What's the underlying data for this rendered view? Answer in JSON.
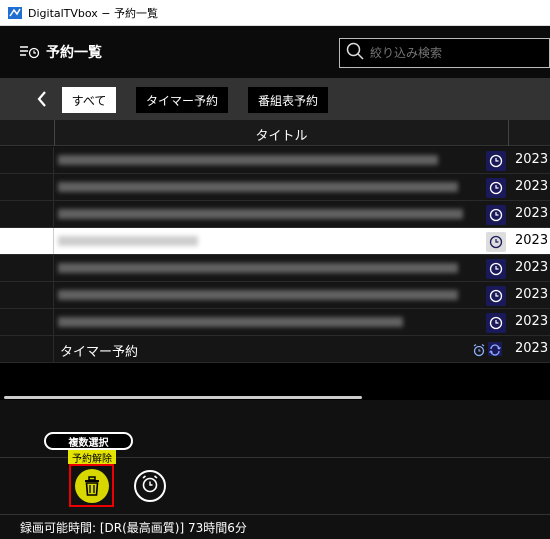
{
  "window": {
    "title": "DigitalTVbox − 予約一覧"
  },
  "header": {
    "title": "予約一覧",
    "search_placeholder": "絞り込み検索"
  },
  "filters": {
    "all": "すべて",
    "timer": "タイマー予約",
    "epg": "番組表予約"
  },
  "table": {
    "column_title": "タイトル",
    "rows": [
      {
        "date": "2023"
      },
      {
        "date": "2023"
      },
      {
        "date": "2023"
      },
      {
        "date": "2023"
      },
      {
        "date": "2023"
      },
      {
        "date": "2023"
      },
      {
        "date": "2023"
      },
      {
        "title": "タイマー予約",
        "date": "2023"
      }
    ]
  },
  "actions": {
    "multi_select": "複数選択",
    "cancel_reservation": "予約解除"
  },
  "status": {
    "recordable_time": "録画可能時間: [DR(最高画質)] 73時間6分"
  },
  "colors": {
    "accent_yellow": "#d8d800",
    "highlight_red": "#e00000",
    "status_icon_bg": "#1a1a5a"
  },
  "icons": {
    "app": "app-icon",
    "list": "list-clock-icon",
    "search": "search-icon",
    "back": "chevron-left-icon",
    "status": "clock-icon",
    "repeat": "repeat-icon",
    "alarm": "alarm-clock-icon",
    "trash": "trash-icon"
  }
}
